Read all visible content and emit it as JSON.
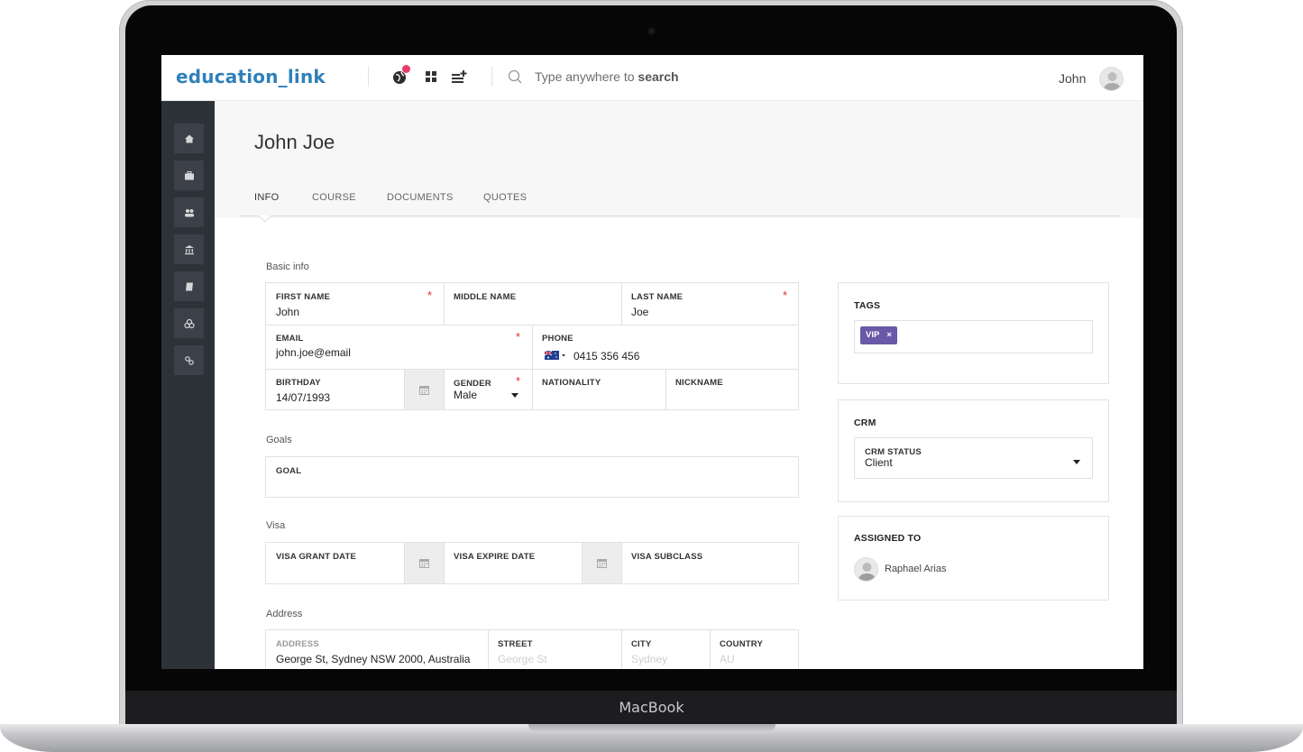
{
  "device": {
    "brand": "MacBook"
  },
  "topbar": {
    "logo": "education_link",
    "search_placeholder": "Type anywhere to",
    "search_keyword": "search",
    "user_name": "John"
  },
  "icons": {
    "topbar": [
      "globe-icon",
      "grid-icon",
      "add-list-icon",
      "search-icon"
    ],
    "sidebar": [
      "home-icon",
      "briefcase-icon",
      "users-icon",
      "bank-icon",
      "book-icon",
      "circles-icon",
      "link-icon"
    ]
  },
  "colors": {
    "accent": "#2f80b9",
    "sidebar": "#2d3138",
    "tag": "#6a58a8",
    "required": "#e02f2f",
    "notification": "#ea3d6b"
  },
  "page": {
    "title": "John Joe",
    "tabs": [
      {
        "label": "INFO",
        "active": true
      },
      {
        "label": "COURSE",
        "active": false
      },
      {
        "label": "DOCUMENTS",
        "active": false
      },
      {
        "label": "QUOTES",
        "active": false
      }
    ]
  },
  "basic_info": {
    "section": "Basic info",
    "first_name": {
      "label": "FIRST NAME",
      "value": "John",
      "required": "*"
    },
    "middle_name": {
      "label": "MIDDLE NAME",
      "value": ""
    },
    "last_name": {
      "label": "LAST NAME",
      "value": "Joe",
      "required": "*"
    },
    "email": {
      "label": "EMAIL",
      "value": "john.joe@email",
      "required": "*"
    },
    "phone": {
      "label": "PHONE",
      "value": "0415 356 456",
      "country_flag": "AU"
    },
    "birthday": {
      "label": "BIRTHDAY",
      "value": "14/07/1993"
    },
    "gender": {
      "label": "GENDER",
      "value": "Male",
      "required": "*"
    },
    "nationality": {
      "label": "NATIONALITY",
      "value": ""
    },
    "nickname": {
      "label": "NICKNAME",
      "value": ""
    }
  },
  "goals": {
    "section": "Goals",
    "goal": {
      "label": "GOAL",
      "value": ""
    }
  },
  "visa": {
    "section": "Visa",
    "grant_date": {
      "label": "VISA GRANT DATE",
      "value": ""
    },
    "expire_date": {
      "label": "VISA EXPIRE DATE",
      "value": ""
    },
    "subclass": {
      "label": "VISA SUBCLASS",
      "value": ""
    }
  },
  "address": {
    "section": "Address",
    "address": {
      "label": "ADDRESS",
      "value": "George St, Sydney NSW 2000, Australia"
    },
    "street": {
      "label": "STREET",
      "placeholder": "George St"
    },
    "city": {
      "label": "CITY",
      "placeholder": "Sydney"
    },
    "country": {
      "label": "COUNTRY",
      "placeholder": "AU"
    }
  },
  "tags": {
    "title": "TAGS",
    "items": [
      {
        "label": "VIP",
        "remove": "×"
      }
    ]
  },
  "crm": {
    "title": "CRM",
    "status_label": "CRM STATUS",
    "status_value": "Client"
  },
  "assigned": {
    "title": "ASSIGNED TO",
    "name": "Raphael Arias"
  }
}
